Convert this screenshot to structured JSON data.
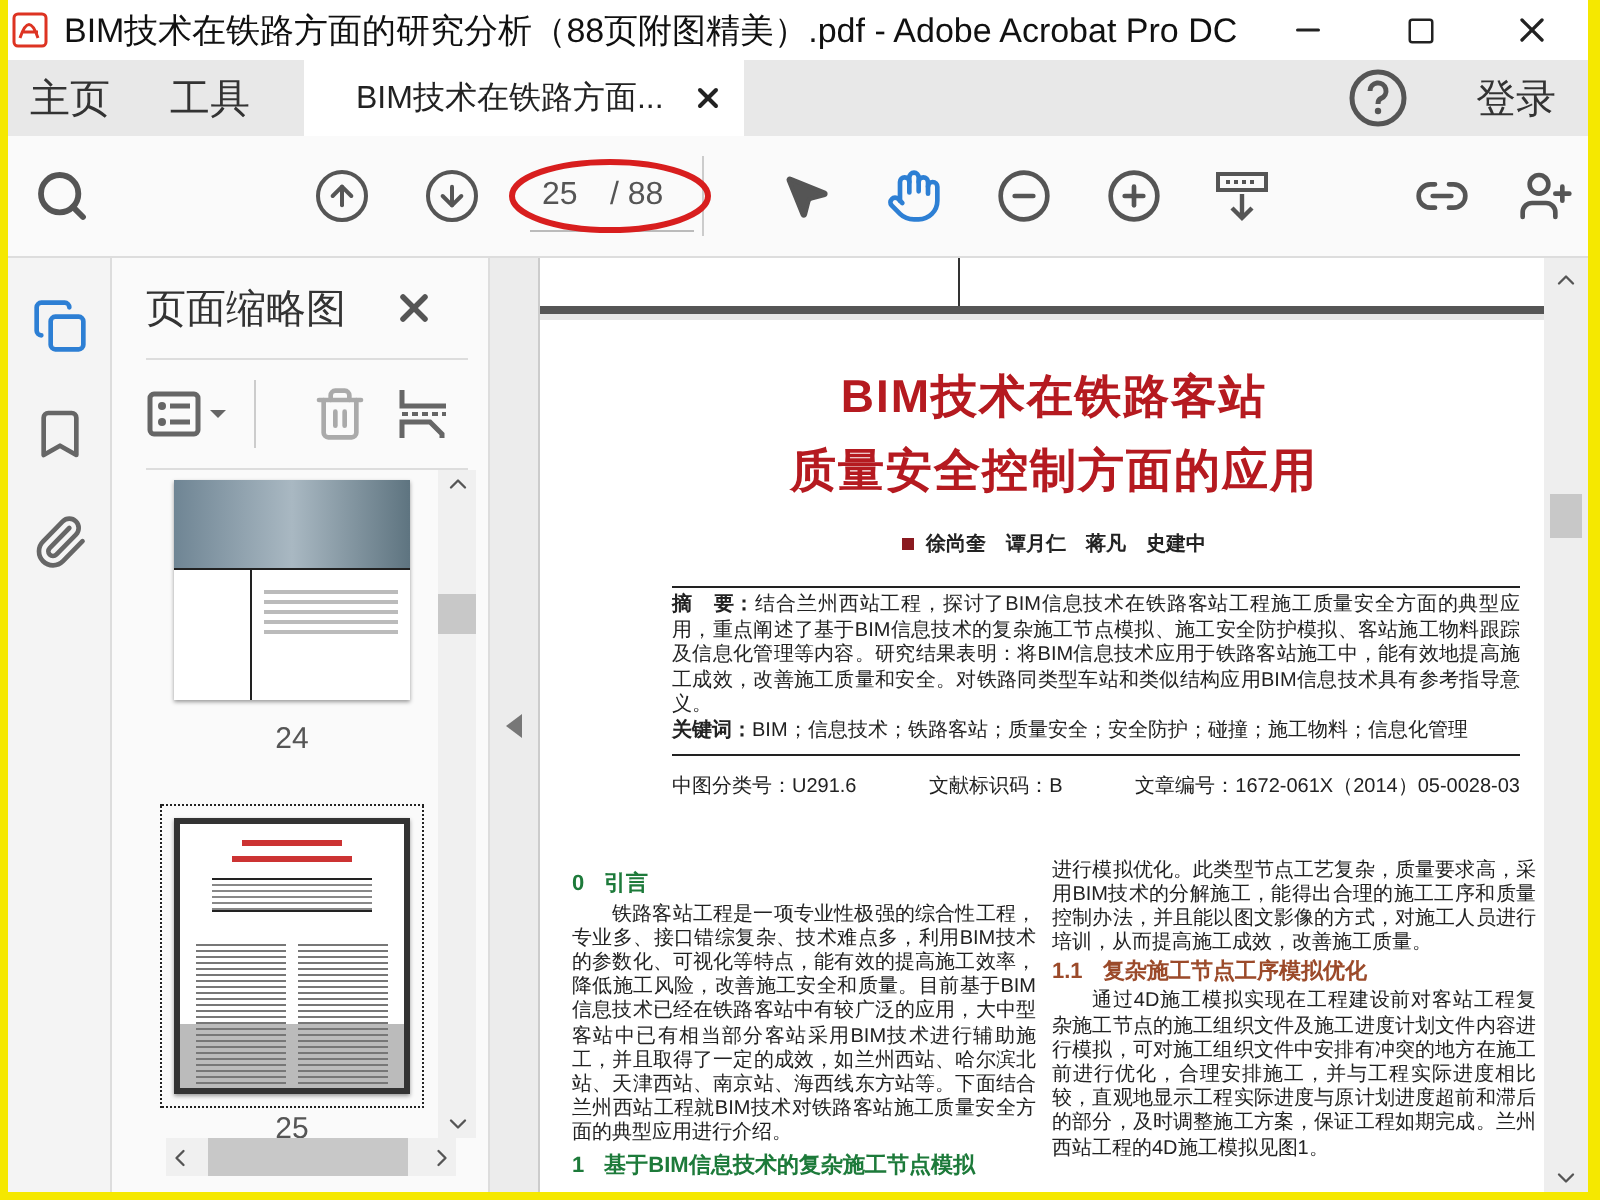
{
  "window": {
    "title": "BIM技术在铁路方面的研究分析（88页附图精美）.pdf - Adobe Acrobat Pro DC"
  },
  "nav": [
    {
      "label": "主页"
    },
    {
      "label": "工具"
    }
  ],
  "tabs": [
    {
      "label": "BIM技术在铁路方面...",
      "selected": true
    }
  ],
  "account": {
    "sign_in": "登录"
  },
  "toolbar": {
    "page_number": "25",
    "page_total": "/ 88",
    "annotated": true,
    "tools": [
      {
        "kind": "select",
        "selected": false
      },
      {
        "kind": "hand",
        "selected": true
      }
    ]
  },
  "sidebar": {
    "rail": [
      {
        "kind": "pages",
        "selected": true
      },
      {
        "kind": "bookmarks",
        "selected": false
      },
      {
        "kind": "attachments",
        "selected": false
      }
    ],
    "panel_title": "页面缩略图",
    "thumbnails": [
      {
        "label": "24",
        "kind": "cover",
        "selected": false
      },
      {
        "label": "25",
        "kind": "article",
        "selected": true
      }
    ]
  },
  "document": {
    "title_lines": [
      "BIM技术在铁路客站",
      "质量安全控制方面的应用"
    ],
    "authors": "徐尚奎　谭月仁　蒋凡　史建中",
    "abstract": "**摘　要：**结合兰州西站工程，探讨了BIM信息技术在铁路客站工程施工质量安全方面的典型应用，重点阐述了基于BIM信息技术的复杂施工节点模拟、施工安全防护模拟、客站施工物料跟踪及信息化管理等内容。研究结果表明：将BIM信息技术应用于铁路客站施工中，能有效地提高施工成效，改善施工质量和安全。对铁路同类型车站和类似结构应用BIM信息技术具有参考指导意义。",
    "keywords": "**关键词：**BIM；信息技术；铁路客站；质量安全；安全防护；碰撞；施工物料；信息化管理",
    "classification": [
      "中图分类号：U291.6",
      "文献标识码：B",
      "文章编号：1672-061X（2014）05-0028-03"
    ],
    "columns": [
      [
        {
          "kind": "heading",
          "number": "0",
          "text": "引言"
        },
        {
          "kind": "paragraph",
          "indent": true,
          "text": "铁路客站工程是一项专业性极强的综合性工程，专业多、接口错综复杂、技术难点多，利用BIM技术的参数化、可视化等特点，能有效的提高施工效率，降低施工风险，改善施工安全和质量。目前基于BIM信息技术已经在铁路客站中有较广泛的应用，大中型客站中已有相当部分客站采用BIM技术进行辅助施工，并且取得了一定的成效，如兰州西站、哈尔滨北站、天津西站、南京站、海西线东方站等。下面结合兰州西站工程就BIM技术对铁路客站施工质量安全方面的典型应用进行介绍。"
        },
        {
          "kind": "heading",
          "number": "1",
          "text": "基于BIM信息技术的复杂施工节点模拟"
        }
      ],
      [
        {
          "kind": "paragraph",
          "indent": false,
          "text": "进行模拟优化。此类型节点工艺复杂，质量要求高，采用BIM技术的分解施工，能得出合理的施工工序和质量控制办法，并且能以图文影像的方式，对施工人员进行培训，从而提高施工成效，改善施工质量。"
        },
        {
          "kind": "subheading",
          "number": "1.1",
          "text": "复杂施工节点工序模拟优化"
        },
        {
          "kind": "paragraph",
          "indent": true,
          "text": "通过4D施工模拟实现在工程建设前对客站工程复杂施工节点的施工组织文件及施工进度计划文件内容进行模拟，可对施工组织文件中安排有冲突的地方在施工前进行优化，合理安排施工，并与工程实际进度相比较，直观地显示工程实际进度与原计划进度超前和滞后的部分，及时调整施工方案，保证工程如期完成。兰州西站工程的4D施工模拟见图1。"
        }
      ]
    ]
  }
}
